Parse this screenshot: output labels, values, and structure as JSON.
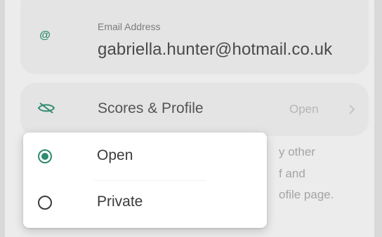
{
  "email": {
    "label": "Email Address",
    "value": "gabriella.hunter@hotmail.co.uk",
    "icon": "at-sign-icon"
  },
  "scores_profile": {
    "label": "Scores & Profile",
    "value": "Open",
    "icon": "eye-slash-icon",
    "chevron": "chevron-right-icon"
  },
  "description_fragments": [
    "y other",
    "f and",
    "ofile page."
  ],
  "dropdown": {
    "options": [
      {
        "label": "Open",
        "selected": true
      },
      {
        "label": "Private",
        "selected": false
      }
    ]
  },
  "colors": {
    "accent": "#2f8a6f",
    "background": "#ececec",
    "card": "#e4e4e4"
  }
}
